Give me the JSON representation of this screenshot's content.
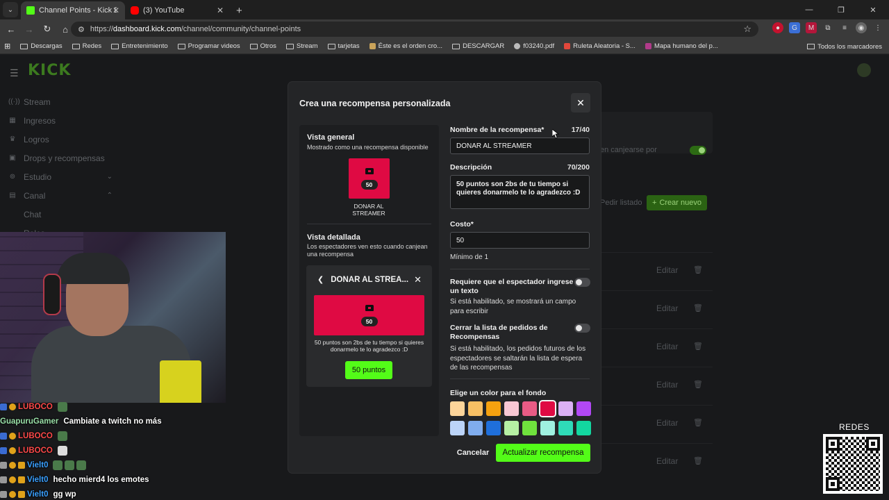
{
  "browser": {
    "tabs": [
      {
        "title": "Channel Points - Kick Dashboard",
        "active": true,
        "favicon": "kick-icon"
      },
      {
        "title": "(3) YouTube",
        "active": false,
        "favicon": "youtube-icon"
      }
    ],
    "url_scheme": "https://",
    "url_host": "dashboard.kick.com",
    "url_path": "/channel/community/channel-points",
    "bookmarks": [
      "Descargas",
      "Redes",
      "Entretenimiento",
      "Programar videos",
      "Otros",
      "Stream",
      "tarjetas",
      "Éste es el orden cro...",
      "DESCARGAR",
      "f03240.pdf",
      "Ruleta Aleatoria - S...",
      "Mapa humano del p..."
    ],
    "all_bookmarks": "Todos los marcadores"
  },
  "sidebar": {
    "logo": "KICK",
    "items": [
      {
        "label": "Stream"
      },
      {
        "label": "Ingresos"
      },
      {
        "label": "Logros"
      },
      {
        "label": "Drops y recompensas"
      },
      {
        "label": "Estudio"
      },
      {
        "label": "Canal"
      }
    ],
    "subitems": [
      "Chat",
      "Roles"
    ]
  },
  "background": {
    "toggle_text": "en canjearse por",
    "pedir_listado": "Pedir listado",
    "crear_nuevo": "Crear nuevo",
    "edit_label": "Editar"
  },
  "chat": [
    {
      "user": "LUBOCO",
      "msg": "",
      "color": "#ff4a4a"
    },
    {
      "user": "GuapuruGamer",
      "msg": "Cambiate a twitch no más",
      "color": "#9ae0a8"
    },
    {
      "user": "LUBOCO",
      "msg": "",
      "color": "#ff4a4a"
    },
    {
      "user": "LUBOCO",
      "msg": "",
      "color": "#ff4a4a"
    },
    {
      "user": "Vielt0",
      "msg": "",
      "color": "#3aa0ff"
    },
    {
      "user": "Vielt0",
      "msg": "hecho mierd4 los emotes",
      "color": "#3aa0ff"
    },
    {
      "user": "Vielt0",
      "msg": "gg wp",
      "color": "#3aa0ff"
    }
  ],
  "modal": {
    "title": "Crea una recompensa personalizada",
    "overview": {
      "heading": "Vista general",
      "sub": "Mostrado como una recompensa disponible",
      "card_cost": "50",
      "card_name": "DONAR AL STREAMER"
    },
    "detailed": {
      "heading": "Vista detallada",
      "sub": "Los espectadores ven esto cuando canjean una recompensa",
      "title": "DONAR AL STREA...",
      "cost": "50",
      "description": "50 puntos son 2bs de tu tiempo si quieres donarmelo te lo agradezco :D",
      "button": "50 puntos"
    },
    "form": {
      "name_label": "Nombre de la recompensa*",
      "name_count": "17/40",
      "name_value": "DONAR AL STREAMER",
      "desc_label": "Descripción",
      "desc_count": "70/200",
      "desc_value": "50 puntos son 2bs de tu tiempo si quieres donarmelo te lo agradezco :D",
      "cost_label": "Costo*",
      "cost_value": "50",
      "cost_help": "Mínimo de 1",
      "text_required_label": "Requiere que el espectador ingrese un texto",
      "text_required_help": "Si está habilitado, se mostrará un campo para escribir",
      "close_list_label": "Cerrar la lista de pedidos de Recompensas",
      "close_list_help": "Si está habilitado, los pedidos futuros de los espectadores se saltarán la lista de espera de las recompensas",
      "color_label": "Elige un color para el fondo",
      "colors": [
        "#fdd59a",
        "#f8c064",
        "#f5a10f",
        "#f8c7d4",
        "#e85b85",
        "#df0a43",
        "#dcb0f5",
        "#b248f5",
        "#bcd4f8",
        "#80adee",
        "#1f6fdb",
        "#b6f0a4",
        "#70e23d",
        "#9ff0e0",
        "#2fdbb8",
        "#13d7a0"
      ],
      "selected_color": "#df0a43"
    },
    "cancel": "Cancelar",
    "submit": "Actualizar recompensa"
  },
  "overlay": {
    "redes": "REDES"
  }
}
